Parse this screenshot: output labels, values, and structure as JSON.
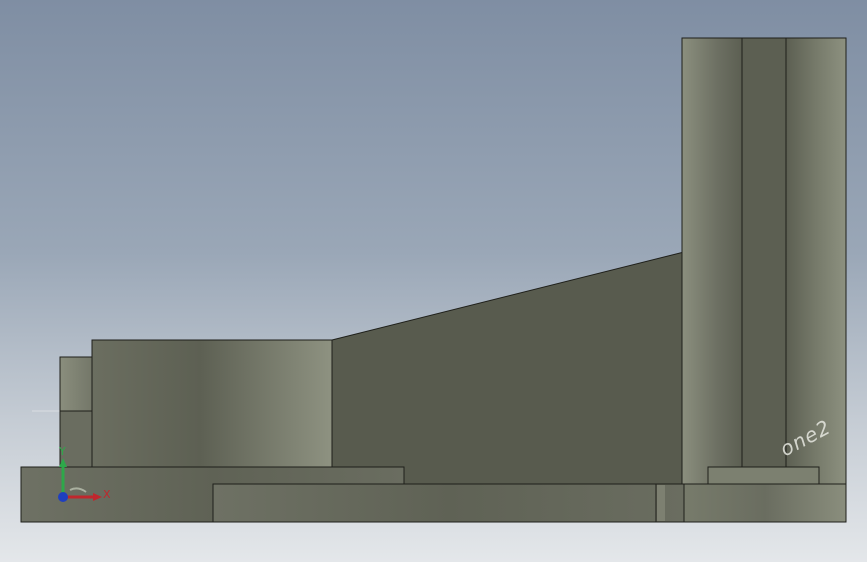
{
  "viewport": {
    "background_top": "#7f8ea3",
    "background_bottom": "#e4e7ea",
    "model_color_dark": "#585b4e",
    "model_color_light": "#8d9180",
    "edge_color": "#1e1f1a"
  },
  "triad": {
    "x_label": "X",
    "y_label": "Y",
    "x_color": "#c0272d",
    "y_color": "#2ea84a",
    "z_color": "#1f3fbf"
  },
  "watermark": {
    "text": "one2"
  }
}
